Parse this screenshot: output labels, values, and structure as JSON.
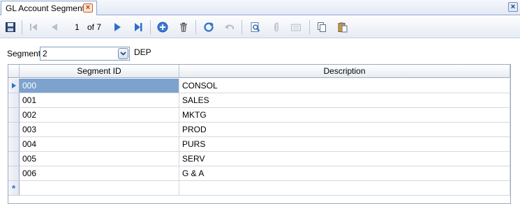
{
  "tab": {
    "title": "GL Account Segments",
    "close_glyph": "×"
  },
  "window": {
    "close_glyph": "×"
  },
  "toolbar": {
    "record_position": "1",
    "record_total": "of 7"
  },
  "segment": {
    "label": "Segment",
    "value": "2",
    "description": "DEP"
  },
  "grid": {
    "columns": [
      "Segment ID",
      "Description"
    ],
    "rows": [
      {
        "id": "000",
        "description": "CONSOL"
      },
      {
        "id": "001",
        "description": "SALES"
      },
      {
        "id": "002",
        "description": "MKTG"
      },
      {
        "id": "003",
        "description": "PROD"
      },
      {
        "id": "004",
        "description": "PURS"
      },
      {
        "id": "005",
        "description": "SERV"
      },
      {
        "id": "006",
        "description": "G & A"
      }
    ],
    "selected_row": 0
  },
  "colors": {
    "selection": "#7da2ce",
    "accent_blue": "#2f6fc9"
  }
}
